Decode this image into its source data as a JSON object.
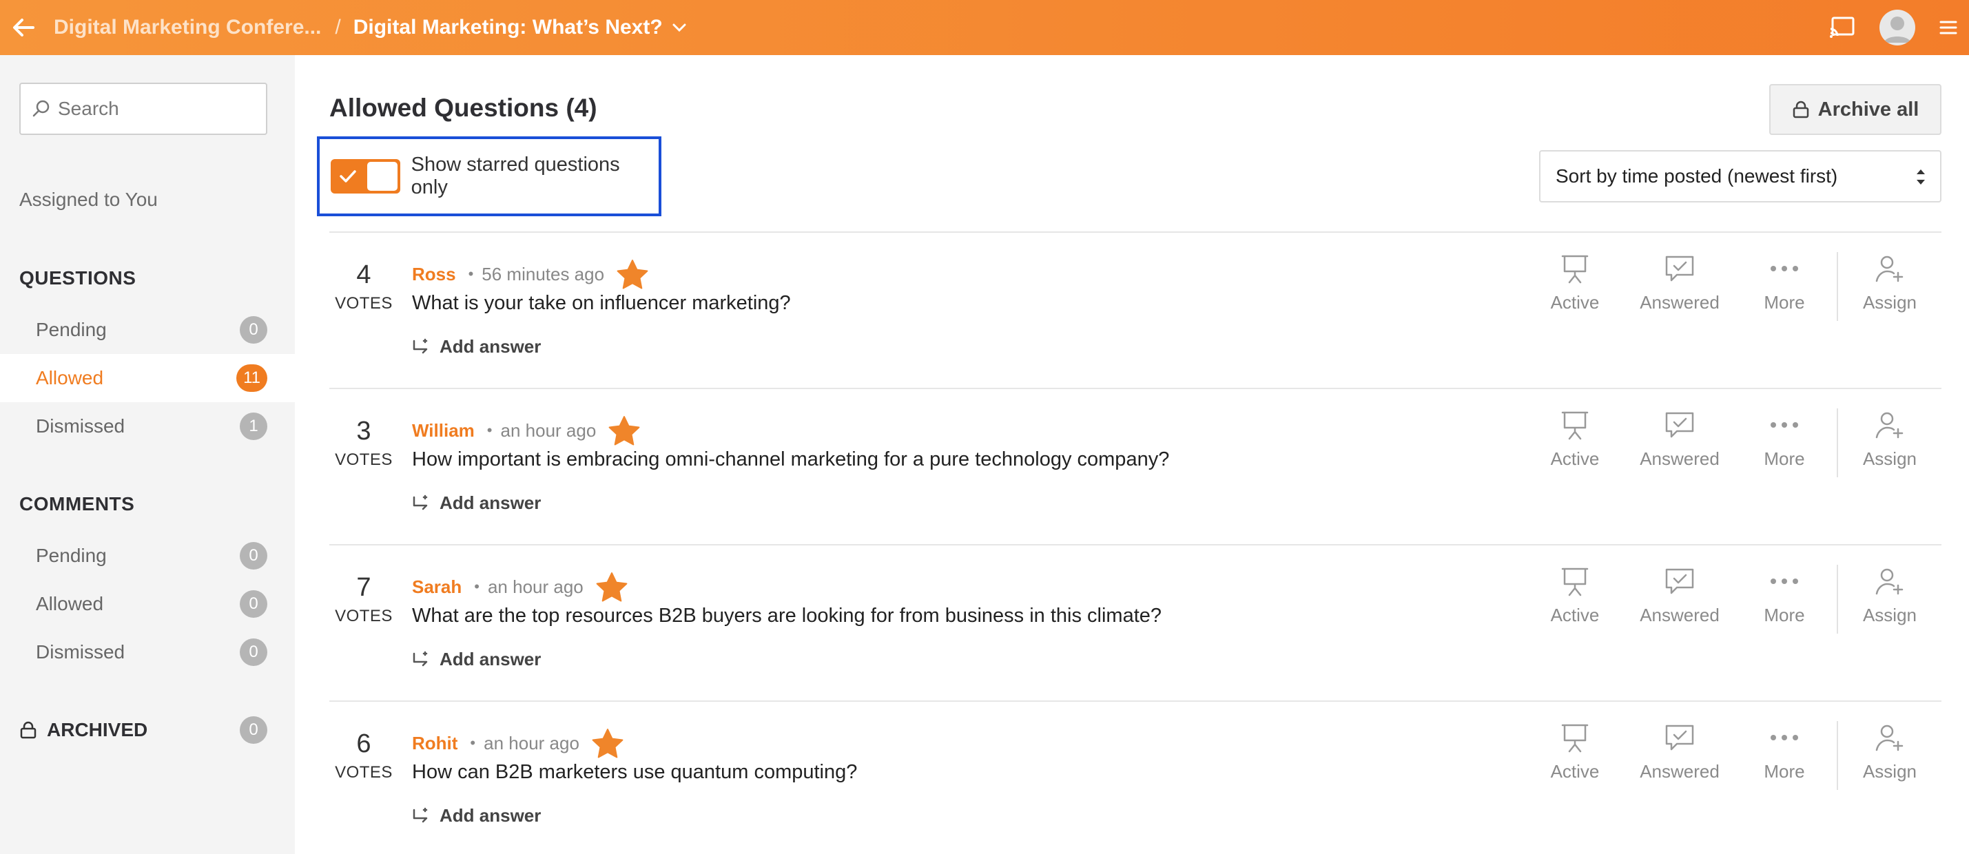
{
  "topbar": {
    "parent": "Digital Marketing Confere...",
    "separator": "/",
    "current": "Digital Marketing: What’s Next?"
  },
  "sidebar": {
    "search_placeholder": "Search",
    "assigned": "Assigned to You",
    "questions_header": "QUESTIONS",
    "questions": [
      {
        "label": "Pending",
        "count": "0"
      },
      {
        "label": "Allowed",
        "count": "11"
      },
      {
        "label": "Dismissed",
        "count": "1"
      }
    ],
    "comments_header": "COMMENTS",
    "comments": [
      {
        "label": "Pending",
        "count": "0"
      },
      {
        "label": "Allowed",
        "count": "0"
      },
      {
        "label": "Dismissed",
        "count": "0"
      }
    ],
    "archived": {
      "label": "ARCHIVED",
      "count": "0"
    }
  },
  "main": {
    "title": "Allowed Questions (4)",
    "archive_all": "Archive all",
    "toggle_label": "Show starred questions only",
    "sort_label": "Sort by time posted (newest first)",
    "votes_label": "VOTES",
    "add_answer": "Add answer",
    "actions": {
      "active": "Active",
      "answered": "Answered",
      "more": "More",
      "assign": "Assign"
    },
    "questions": [
      {
        "votes": "4",
        "author": "Ross",
        "time": "56 minutes ago",
        "text": "What is your take on influencer marketing?"
      },
      {
        "votes": "3",
        "author": "William",
        "time": "an hour ago",
        "text": "How important is embracing omni-channel marketing for a pure technology company?"
      },
      {
        "votes": "7",
        "author": "Sarah",
        "time": "an hour ago",
        "text": "What are the top resources B2B buyers are looking for from business in this climate?"
      },
      {
        "votes": "6",
        "author": "Rohit",
        "time": "an hour ago",
        "text": "How can B2B marketers use quantum computing?"
      }
    ]
  },
  "colors": {
    "accent": "#f07c20",
    "highlight_box": "#1a4fd8",
    "star": "#f0852a"
  }
}
